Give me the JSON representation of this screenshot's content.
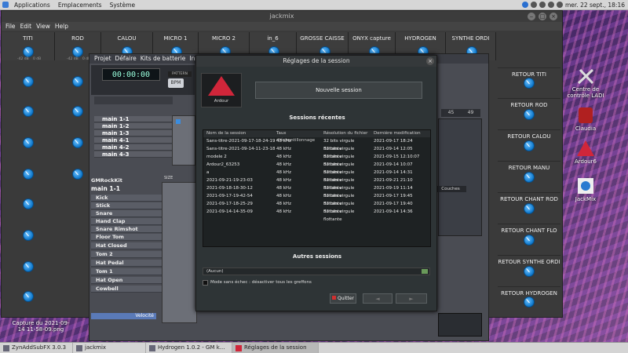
{
  "top_panel": {
    "menus": [
      "Applications",
      "Emplacements",
      "Système"
    ],
    "clock": "mer. 22 sept., 18:16"
  },
  "desktop_icons": [
    {
      "label": "Centre de contrôle LADI"
    },
    {
      "label": "Claudia"
    },
    {
      "label": "Ardour6"
    },
    {
      "label": "JackMix"
    }
  ],
  "jackmix": {
    "title": "jackmix",
    "menu": [
      "File",
      "Edit",
      "View",
      "Help"
    ],
    "channels": [
      "TITI",
      "ROD",
      "CALOU",
      "MICRO 1",
      "MICRO 2",
      "in_6",
      "GROSSE CAISSE",
      "ONYX capture",
      "HYDROGEN",
      "SYNTHE ORDI"
    ],
    "knob_min": "-42 dB",
    "knob_max": "0 dB",
    "retours": [
      "RETOUR TITI",
      "RETOUR ROD",
      "RETOUR CALOU",
      "RETOUR MANU",
      "RETOUR CHANT ROD",
      "RETOUR CHANT FLO",
      "RETOUR SYNTHE ORDI",
      "RETOUR HYDROGEN"
    ]
  },
  "hydrogen": {
    "menu": [
      "Projet",
      "Défaire",
      "Kits de batterie",
      "Instr"
    ],
    "timecode": "00:00:00",
    "bpm": "BPM",
    "pattern_label": "PATTERN",
    "patterns": [
      "main 1-1",
      "main 1-2",
      "main 1-3",
      "main 4-1",
      "main 4-2",
      "main 4-3"
    ],
    "kit": "GMRockKit",
    "selected_pattern": "main 1-1",
    "size_label": "SIZE",
    "instruments": [
      "Kick",
      "Stick",
      "Snare",
      "Hand Clap",
      "Snare Rimshot",
      "Floor Tom",
      "Hat Closed",
      "Tom 2",
      "Hat Pedal",
      "Tom 1",
      "Hat Open",
      "Cowbell"
    ],
    "velocity": "Velocité",
    "ruler": [
      "45",
      "49"
    ],
    "right_label": "Couches"
  },
  "dialog": {
    "title": "Réglages de la session",
    "new_session": "Nouvelle session",
    "recent_title": "Sessions récentes",
    "columns": [
      "Nom de la session",
      "Taux d'échantillonnage",
      "Résolution du fichier",
      "Dernière modification"
    ],
    "sessions": [
      {
        "name": "Sans-titre-2021-09-17-18-24-19",
        "rate": "48 kHz",
        "res": "32 bits virgule flottante",
        "mod": "2021-09-17 18:24"
      },
      {
        "name": "Sans-titre-2021-09-14-11-23-18",
        "rate": "48 kHz",
        "res": "32 bits virgule flottante",
        "mod": "2021-09-14 12:05"
      },
      {
        "name": "modele 2",
        "rate": "48 kHz",
        "res": "32 bits virgule flottante",
        "mod": "2021-09-15 12:10:07"
      },
      {
        "name": "Ardour2_63253",
        "rate": "48 kHz",
        "res": "32 bits virgule flottante",
        "mod": "2021-09-14 10:07"
      },
      {
        "name": "a",
        "rate": "48 kHz",
        "res": "32 bits virgule flottante",
        "mod": "2021-09-14 14:31"
      },
      {
        "name": "2021-09-21-19-23-03",
        "rate": "48 kHz",
        "res": "32 bits virgule flottante",
        "mod": "2021-09-21 21:10"
      },
      {
        "name": "2021-09-18-18-30-12",
        "rate": "48 kHz",
        "res": "32 bits virgule flottante",
        "mod": "2021-09-19 11:14"
      },
      {
        "name": "2021-09-17-19-42-54",
        "rate": "48 kHz",
        "res": "32 bits virgule flottante",
        "mod": "2021-09-17 19:45"
      },
      {
        "name": "2021-09-17-18-25-29",
        "rate": "48 kHz",
        "res": "32 bits virgule flottante",
        "mod": "2021-09-17 19:40"
      },
      {
        "name": "2021-09-14-14-35-09",
        "rate": "48 kHz",
        "res": "32 bits virgule flottante",
        "mod": "2021-09-14 14:36"
      }
    ],
    "other_title": "Autres sessions",
    "other_value": "(Aucun)",
    "safe_mode": "Mode sans échec : désactiver tous les greffons",
    "quit": "Quitter",
    "logo": "Ardour"
  },
  "taskbar": {
    "tasks": [
      "ZynAddSubFX 3.0.3",
      "jackmix",
      "Hydrogen 1.0.2 - GM k...",
      "Réglages de la session"
    ]
  },
  "capture_label": "Capture du 2021-09-14 11-58-09.png"
}
